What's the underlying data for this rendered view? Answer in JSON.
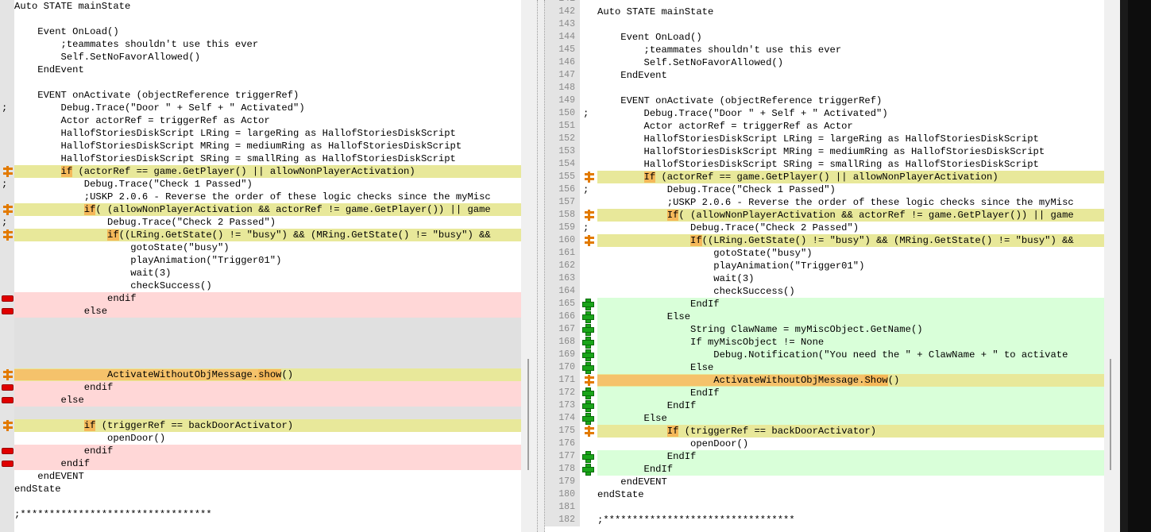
{
  "left_lines": [
    {
      "type": "normal",
      "text": "Auto STATE mainState"
    },
    {
      "type": "normal",
      "text": ""
    },
    {
      "type": "normal",
      "text": "    Event OnLoad()"
    },
    {
      "type": "normal",
      "text": "        ;teammates shouldn't use this ever"
    },
    {
      "type": "normal",
      "text": "        Self.SetNoFavorAllowed()"
    },
    {
      "type": "normal",
      "text": "    EndEvent"
    },
    {
      "type": "normal",
      "text": ""
    },
    {
      "type": "normal",
      "text": "    EVENT onActivate (objectReference triggerRef)"
    },
    {
      "type": "normal",
      "text": "        Debug.Trace(\"Door \" + Self + \" Activated\")",
      "marker": "semi"
    },
    {
      "type": "normal",
      "text": "        Actor actorRef = triggerRef as Actor"
    },
    {
      "type": "normal",
      "text": "        HallofStoriesDiskScript LRing = largeRing as HallofStoriesDiskScript"
    },
    {
      "type": "normal",
      "text": "        HallofStoriesDiskScript MRing = mediumRing as HallofStoriesDiskScript"
    },
    {
      "type": "normal",
      "text": "        HallofStoriesDiskScript SRing = smallRing as HallofStoriesDiskScript"
    },
    {
      "type": "changed",
      "marker": "change",
      "pre": "        ",
      "hl": "if",
      "post": " (actorRef == game.GetPlayer() || allowNonPlayerActivation)"
    },
    {
      "type": "normal",
      "text": "            Debug.Trace(\"Check 1 Passed\")",
      "marker": "semi"
    },
    {
      "type": "normal",
      "text": "            ;USKP 2.0.6 - Reverse the order of these logic checks since the myMisc"
    },
    {
      "type": "changed",
      "marker": "change",
      "pre": "            ",
      "hl": "if",
      "post": "( (allowNonPlayerActivation && actorRef != game.GetPlayer()) || game"
    },
    {
      "type": "normal",
      "text": "                Debug.Trace(\"Check 2 Passed\")",
      "marker": "semi"
    },
    {
      "type": "changed",
      "marker": "change",
      "pre": "                ",
      "hl": "if",
      "post": "((LRing.GetState() != \"busy\") && (MRing.GetState() != \"busy\") &&"
    },
    {
      "type": "normal",
      "text": "                    gotoState(\"busy\")"
    },
    {
      "type": "normal",
      "text": "                    playAnimation(\"Trigger01\")"
    },
    {
      "type": "normal",
      "text": "                    wait(3)"
    },
    {
      "type": "normal",
      "text": "                    checkSuccess()"
    },
    {
      "type": "removed",
      "marker": "minus",
      "text": "                endif"
    },
    {
      "type": "removed",
      "marker": "minus",
      "text": "            else"
    },
    {
      "type": "blank",
      "text": ""
    },
    {
      "type": "blank",
      "text": ""
    },
    {
      "type": "blank",
      "text": ""
    },
    {
      "type": "blank",
      "text": ""
    },
    {
      "type": "current",
      "marker": "change",
      "pre": "                ActivateWithoutObjMessage.",
      "hl": "show",
      "post": "()"
    },
    {
      "type": "removed",
      "marker": "minus",
      "text": "            endif"
    },
    {
      "type": "removed",
      "marker": "minus",
      "text": "        else"
    },
    {
      "type": "blank",
      "text": ""
    },
    {
      "type": "changed",
      "marker": "change",
      "pre": "            ",
      "hl": "if",
      "post": " (triggerRef == backDoorActivator)"
    },
    {
      "type": "normal",
      "text": "                openDoor()"
    },
    {
      "type": "removed",
      "marker": "minus",
      "text": "            endif"
    },
    {
      "type": "removed",
      "marker": "minus",
      "text": "        endif"
    },
    {
      "type": "normal",
      "text": "    endEVENT"
    },
    {
      "type": "normal",
      "text": "endState"
    },
    {
      "type": "normal",
      "text": ""
    },
    {
      "type": "normal",
      "text": ";*********************************"
    },
    {
      "type": "normal",
      "text": ""
    }
  ],
  "right_lines": [
    {
      "num": "141",
      "type": "normal",
      "text": ""
    },
    {
      "num": "142",
      "type": "normal",
      "text": "Auto STATE mainState"
    },
    {
      "num": "143",
      "type": "normal",
      "text": ""
    },
    {
      "num": "144",
      "type": "normal",
      "text": "    Event OnLoad()"
    },
    {
      "num": "145",
      "type": "normal",
      "text": "        ;teammates shouldn't use this ever"
    },
    {
      "num": "146",
      "type": "normal",
      "text": "        Self.SetNoFavorAllowed()"
    },
    {
      "num": "147",
      "type": "normal",
      "text": "    EndEvent"
    },
    {
      "num": "148",
      "type": "normal",
      "text": ""
    },
    {
      "num": "149",
      "type": "normal",
      "text": "    EVENT onActivate (objectReference triggerRef)"
    },
    {
      "num": "150",
      "type": "normal",
      "text": "        Debug.Trace(\"Door \" + Self + \" Activated\")",
      "marker": "semi"
    },
    {
      "num": "151",
      "type": "normal",
      "text": "        Actor actorRef = triggerRef as Actor"
    },
    {
      "num": "152",
      "type": "normal",
      "text": "        HallofStoriesDiskScript LRing = largeRing as HallofStoriesDiskScript"
    },
    {
      "num": "153",
      "type": "normal",
      "text": "        HallofStoriesDiskScript MRing = mediumRing as HallofStoriesDiskScript"
    },
    {
      "num": "154",
      "type": "normal",
      "text": "        HallofStoriesDiskScript SRing = smallRing as HallofStoriesDiskScript"
    },
    {
      "num": "155",
      "type": "changed",
      "marker": "change",
      "pre": "        ",
      "hl": "If",
      "post": " (actorRef == game.GetPlayer() || allowNonPlayerActivation)"
    },
    {
      "num": "156",
      "type": "normal",
      "text": "            Debug.Trace(\"Check 1 Passed\")",
      "marker": "semi"
    },
    {
      "num": "157",
      "type": "normal",
      "text": "            ;USKP 2.0.6 - Reverse the order of these logic checks since the myMisc"
    },
    {
      "num": "158",
      "type": "changed",
      "marker": "change",
      "pre": "            ",
      "hl": "If",
      "post": "( (allowNonPlayerActivation && actorRef != game.GetPlayer()) || game"
    },
    {
      "num": "159",
      "type": "normal",
      "text": "                Debug.Trace(\"Check 2 Passed\")",
      "marker": "semi"
    },
    {
      "num": "160",
      "type": "changed",
      "marker": "change",
      "pre": "                ",
      "hl": "If",
      "post": "((LRing.GetState() != \"busy\") && (MRing.GetState() != \"busy\") &&"
    },
    {
      "num": "161",
      "type": "normal",
      "text": "                    gotoState(\"busy\")"
    },
    {
      "num": "162",
      "type": "normal",
      "text": "                    playAnimation(\"Trigger01\")"
    },
    {
      "num": "163",
      "type": "normal",
      "text": "                    wait(3)"
    },
    {
      "num": "164",
      "type": "normal",
      "text": "                    checkSuccess()"
    },
    {
      "num": "165",
      "type": "added",
      "marker": "plus",
      "text": "                EndIf"
    },
    {
      "num": "166",
      "type": "added",
      "marker": "plus",
      "text": "            Else"
    },
    {
      "num": "167",
      "type": "added",
      "marker": "plus",
      "text": "                String ClawName = myMiscObject.GetName()"
    },
    {
      "num": "168",
      "type": "added",
      "marker": "plus",
      "text": "                If myMiscObject != None"
    },
    {
      "num": "169",
      "type": "added",
      "marker": "plus",
      "text": "                    Debug.Notification(\"You need the \" + ClawName + \" to activate"
    },
    {
      "num": "170",
      "type": "added",
      "marker": "plus",
      "text": "                Else"
    },
    {
      "num": "171",
      "type": "current",
      "marker": "change",
      "pre": "                    ActivateWithoutObjMessage.",
      "hl": "Show",
      "post": "()"
    },
    {
      "num": "172",
      "type": "added",
      "marker": "plus",
      "text": "                EndIf"
    },
    {
      "num": "173",
      "type": "added",
      "marker": "plus",
      "text": "            EndIf"
    },
    {
      "num": "174",
      "type": "added",
      "marker": "plus",
      "text": "        Else"
    },
    {
      "num": "175",
      "type": "changed",
      "marker": "change",
      "pre": "            ",
      "hl": "If",
      "post": " (triggerRef == backDoorActivator)"
    },
    {
      "num": "176",
      "type": "normal",
      "text": "                openDoor()"
    },
    {
      "num": "177",
      "type": "added",
      "marker": "plus",
      "text": "            EndIf"
    },
    {
      "num": "178",
      "type": "added",
      "marker": "plus",
      "text": "        EndIf"
    },
    {
      "num": "179",
      "type": "normal",
      "text": "    endEVENT"
    },
    {
      "num": "180",
      "type": "normal",
      "text": "endState"
    },
    {
      "num": "181",
      "type": "normal",
      "text": ""
    },
    {
      "num": "182",
      "type": "normal",
      "text": ";*********************************"
    }
  ],
  "colors": {
    "changed": "#e8e89a",
    "removed": "#ffd7d7",
    "added": "#d9ffd9",
    "highlight": "#f5b85a"
  }
}
